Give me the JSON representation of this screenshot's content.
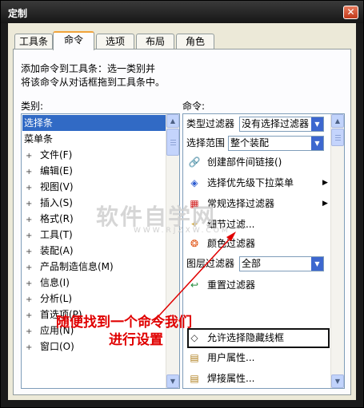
{
  "window": {
    "title": "定制",
    "close_glyph": "✕"
  },
  "tabs": [
    {
      "label": "工具条",
      "active": false
    },
    {
      "label": "命令",
      "active": true
    },
    {
      "label": "选项",
      "active": false
    },
    {
      "label": "布局",
      "active": false
    },
    {
      "label": "角色",
      "active": false
    }
  ],
  "description": {
    "line1": "添加命令到工具条：选一类别并",
    "line2": "将该命令从对话框拖到工具条中。"
  },
  "categories": {
    "label": "类别:",
    "items": [
      {
        "label": "选择条",
        "tree": "",
        "selected": true
      },
      {
        "label": "菜单条",
        "tree": "",
        "selected": false
      },
      {
        "label": "文件(F)",
        "tree": "+",
        "selected": false
      },
      {
        "label": "编辑(E)",
        "tree": "+",
        "selected": false
      },
      {
        "label": "视图(V)",
        "tree": "+",
        "selected": false
      },
      {
        "label": "插入(S)",
        "tree": "+",
        "selected": false
      },
      {
        "label": "格式(R)",
        "tree": "+",
        "selected": false
      },
      {
        "label": "工具(T)",
        "tree": "+",
        "selected": false
      },
      {
        "label": "装配(A)",
        "tree": "+",
        "selected": false
      },
      {
        "label": "产品制造信息(M)",
        "tree": "+",
        "selected": false
      },
      {
        "label": "信息(I)",
        "tree": "+",
        "selected": false
      },
      {
        "label": "分析(L)",
        "tree": "+",
        "selected": false
      },
      {
        "label": "首选项(P)",
        "tree": "+",
        "selected": false
      },
      {
        "label": "应用(N)",
        "tree": "+",
        "selected": false
      },
      {
        "label": "窗口(O)",
        "tree": "+",
        "selected": false
      }
    ]
  },
  "commands": {
    "label": "命令:",
    "type_filter": {
      "label": "类型过滤器",
      "value": "没有选择过滤器"
    },
    "scope": {
      "label": "选择范围",
      "value": "整个装配"
    },
    "layer_filter": {
      "label": "图层过滤器",
      "value": "全部"
    },
    "items": [
      {
        "label": "创建部件间链接()",
        "icon": "🔗",
        "submenu": false
      },
      {
        "label": "选择优先级下拉菜单",
        "icon": "◈",
        "submenu": true
      },
      {
        "label": "常规选择过滤器",
        "icon": "▦",
        "submenu": true
      },
      {
        "label": "细节过滤...",
        "icon": "✦",
        "submenu": false
      },
      {
        "label": "颜色过滤器",
        "icon": "❂",
        "submenu": false
      },
      {
        "label": "重置过滤器",
        "icon": "↩",
        "submenu": false
      },
      {
        "label": "允许选择隐藏线框",
        "icon": "◇",
        "submenu": false
      },
      {
        "label": "用户属性...",
        "icon": "▤",
        "submenu": false
      },
      {
        "label": "焊接属性...",
        "icon": "▤",
        "submenu": false
      }
    ]
  },
  "watermark": {
    "text": "软件自学网",
    "url": "WWW.RJZXW.COM"
  },
  "annotation": {
    "line1": "随便找到一个命令我们",
    "line2": "进行设置"
  },
  "colors": {
    "accent": "#316ac5",
    "annotation": "#e00000"
  }
}
